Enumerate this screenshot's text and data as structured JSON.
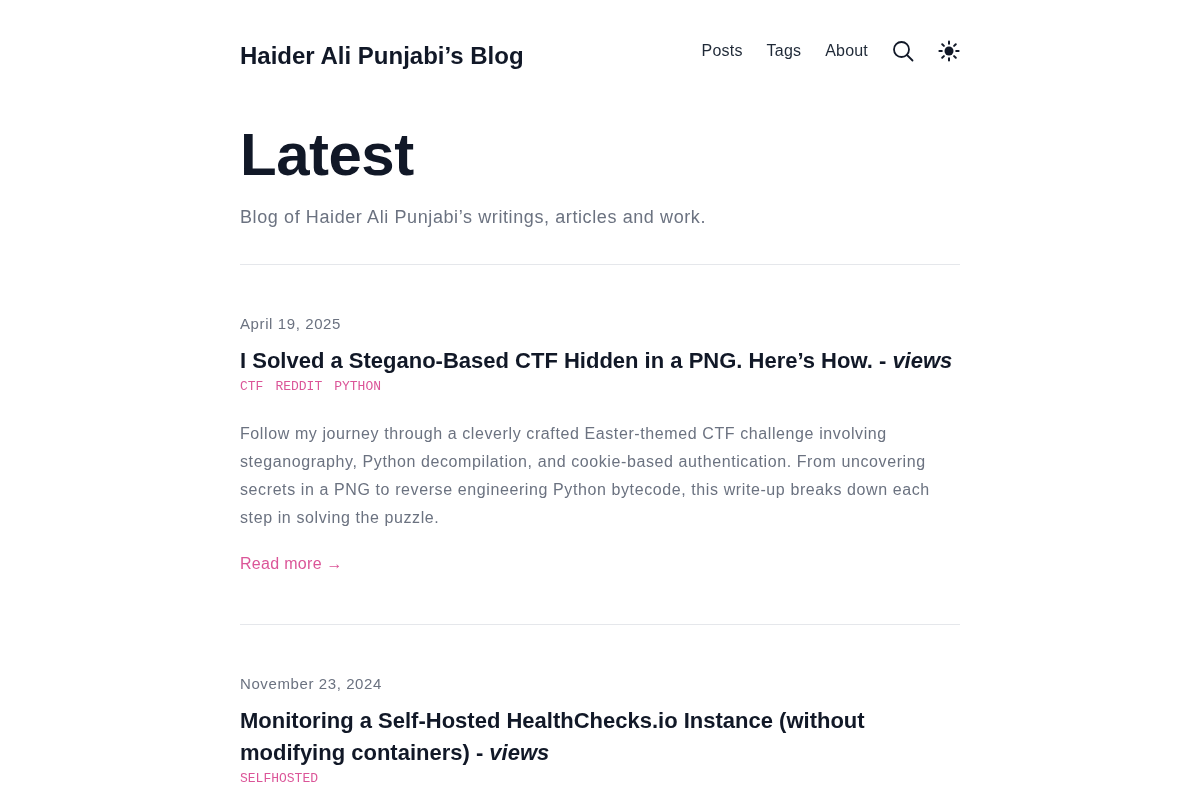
{
  "site": {
    "title": "Haider Ali Punjabi’s Blog"
  },
  "nav": [
    {
      "label": "Posts"
    },
    {
      "label": "Tags"
    },
    {
      "label": "About"
    }
  ],
  "page": {
    "heading": "Latest",
    "subtitle": "Blog of Haider Ali Punjabi’s writings, articles and work."
  },
  "posts": [
    {
      "date": "April 19, 2025",
      "title": "I Solved a Stegano-Based CTF Hidden in a PNG. Here’s How. - *views*",
      "tags": [
        "CTF",
        "REDDIT",
        "PYTHON"
      ],
      "summary": "Follow my journey through a cleverly crafted Easter-themed CTF challenge involving steganography, Python decompilation, and cookie-based authentication. From uncovering secrets in a PNG to reverse engineering Python bytecode, this write-up breaks down each step in solving the puzzle.",
      "read_more": "Read more →"
    },
    {
      "date": "November 23, 2024",
      "title": "Monitoring a Self-Hosted HealthChecks.io Instance (without modifying containers) - *views*",
      "tags": [
        "SELFHOSTED"
      ]
    }
  ]
}
